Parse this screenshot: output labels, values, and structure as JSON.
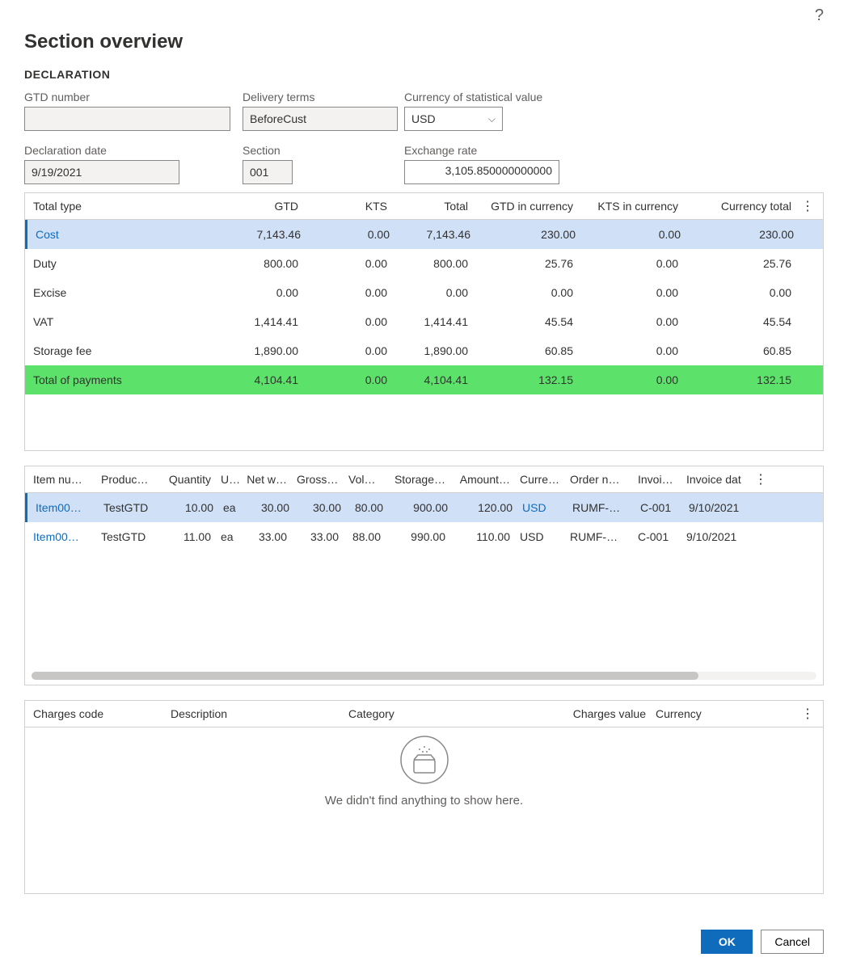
{
  "header": {
    "title": "Section overview",
    "section_heading": "DECLARATION"
  },
  "fields": {
    "gtd_number": {
      "label": "GTD number",
      "value": ""
    },
    "delivery_terms": {
      "label": "Delivery terms",
      "value": "BeforeCust"
    },
    "currency_stat": {
      "label": "Currency of statistical value",
      "value": "USD"
    },
    "declaration_date": {
      "label": "Declaration date",
      "value": "9/19/2021"
    },
    "section": {
      "label": "Section",
      "value": "001"
    },
    "exchange_rate": {
      "label": "Exchange rate",
      "value": "3,105.850000000000"
    }
  },
  "totals_grid": {
    "columns": [
      "Total type",
      "GTD",
      "KTS",
      "Total",
      "GTD in currency",
      "KTS in currency",
      "Currency total"
    ],
    "rows": [
      {
        "type": "Cost",
        "gtd": "7,143.46",
        "kts": "0.00",
        "total": "7,143.46",
        "gtdc": "230.00",
        "ktsc": "0.00",
        "ctotal": "230.00",
        "style": "selected"
      },
      {
        "type": "Duty",
        "gtd": "800.00",
        "kts": "0.00",
        "total": "800.00",
        "gtdc": "25.76",
        "ktsc": "0.00",
        "ctotal": "25.76",
        "style": ""
      },
      {
        "type": "Excise",
        "gtd": "0.00",
        "kts": "0.00",
        "total": "0.00",
        "gtdc": "0.00",
        "ktsc": "0.00",
        "ctotal": "0.00",
        "style": ""
      },
      {
        "type": "VAT",
        "gtd": "1,414.41",
        "kts": "0.00",
        "total": "1,414.41",
        "gtdc": "45.54",
        "ktsc": "0.00",
        "ctotal": "45.54",
        "style": ""
      },
      {
        "type": "Storage fee",
        "gtd": "1,890.00",
        "kts": "0.00",
        "total": "1,890.00",
        "gtdc": "60.85",
        "ktsc": "0.00",
        "ctotal": "60.85",
        "style": ""
      },
      {
        "type": "Total of payments",
        "gtd": "4,104.41",
        "kts": "0.00",
        "total": "4,104.41",
        "gtdc": "132.15",
        "ktsc": "0.00",
        "ctotal": "132.15",
        "style": "green"
      }
    ]
  },
  "items_grid": {
    "columns": [
      "Item nu…",
      "Produc…",
      "Quantity",
      "U…",
      "Net w…",
      "Gross …",
      "Volu…",
      "Storage…",
      "Amount…",
      "Curre…",
      "Order n…",
      "Invoi…",
      "Invoice dat"
    ],
    "rows": [
      {
        "item": "Item00…",
        "prod": "TestGTD",
        "qty": "10.00",
        "unit": "ea",
        "netw": "30.00",
        "grossw": "30.00",
        "vol": "80.00",
        "storage": "900.00",
        "amount": "120.00",
        "curr": "USD",
        "order": "RUMF-…",
        "inv": "C-001",
        "invdate": "9/10/2021",
        "style": "selected"
      },
      {
        "item": "Item00…",
        "prod": "TestGTD",
        "qty": "11.00",
        "unit": "ea",
        "netw": "33.00",
        "grossw": "33.00",
        "vol": "88.00",
        "storage": "990.00",
        "amount": "110.00",
        "curr": "USD",
        "order": "RUMF-…",
        "inv": "C-001",
        "invdate": "9/10/2021",
        "style": ""
      }
    ]
  },
  "charges_grid": {
    "columns": [
      "Charges code",
      "Description",
      "Category",
      "Charges value",
      "Currency"
    ],
    "empty_message": "We didn't find anything to show here."
  },
  "footer": {
    "ok": "OK",
    "cancel": "Cancel"
  }
}
